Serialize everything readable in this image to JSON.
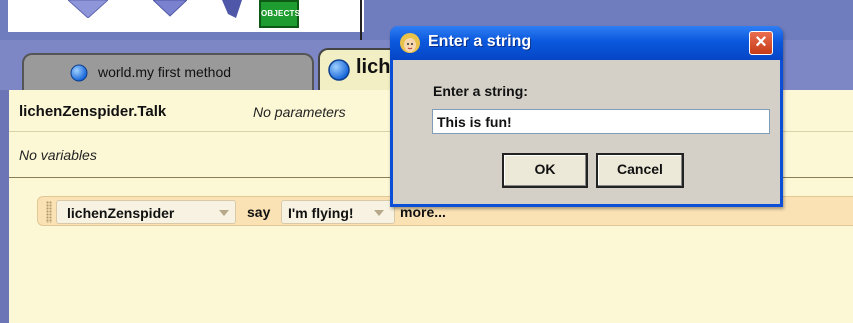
{
  "toolbar": {
    "objects_label": "OBJECTS",
    "icons": [
      "arrow-down-icon",
      "arrow-down-icon",
      "wing-icon"
    ]
  },
  "tabs": [
    {
      "label": "world.my first method",
      "icon": "blue-ball-icon"
    },
    {
      "label": "lich",
      "icon": "blue-ball-icon"
    }
  ],
  "editor": {
    "method_name": "lichenZenspider.Talk",
    "params_text": "No parameters",
    "vars_text": "No variables",
    "statement": {
      "object": "lichenZenspider",
      "verb": "say",
      "value": "I'm flying!",
      "more": "more..."
    }
  },
  "dialog": {
    "title": "Enter a string",
    "prompt": "Enter a string:",
    "input_value": "This is fun!",
    "ok_label": "OK",
    "cancel_label": "Cancel",
    "close_glyph": "×"
  },
  "colors": {
    "work_background": "#7d87c6",
    "editor_background": "#fcf8d6",
    "statement_background": "#fbe2b5",
    "xp_titlebar": "#0a58de"
  }
}
